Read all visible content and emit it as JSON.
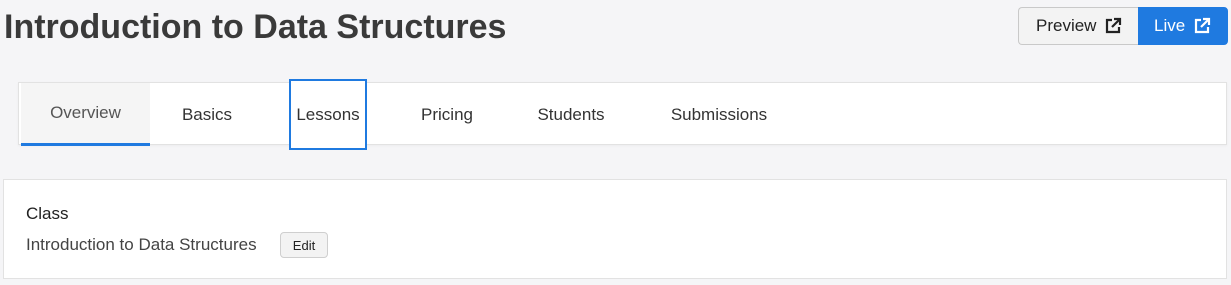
{
  "header": {
    "title": "Introduction to Data Structures",
    "preview_label": "Preview",
    "live_label": "Live"
  },
  "tabs": [
    {
      "label": "Overview",
      "active": true
    },
    {
      "label": "Basics",
      "active": false
    },
    {
      "label": "Lessons",
      "active": false,
      "focused": true
    },
    {
      "label": "Pricing",
      "active": false
    },
    {
      "label": "Students",
      "active": false
    },
    {
      "label": "Submissions",
      "active": false
    }
  ],
  "class_section": {
    "label": "Class",
    "name": "Introduction to Data Structures",
    "edit_label": "Edit"
  },
  "icons": {
    "preview_icon": "external-link-icon",
    "live_icon": "external-link-icon"
  },
  "colors": {
    "accent": "#1f7ae0",
    "background": "#f5f5f7"
  }
}
